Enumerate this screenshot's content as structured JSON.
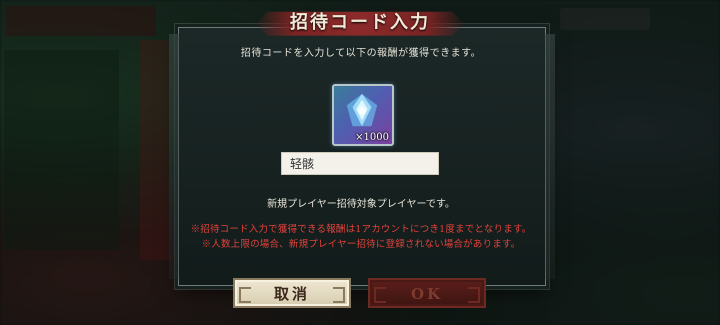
{
  "dialog": {
    "title": "招待コード入力",
    "subtitle": "招待コードを入力して以下の報酬が獲得できます。",
    "reward": {
      "icon": "crystal-icon",
      "quantity": "×1000"
    },
    "input_value": "轻骸",
    "info": "新規プレイヤー招待対象プレイヤーです。",
    "notes": [
      "※招待コード入力で獲得できる報酬は1アカウントにつき1度までとなります。",
      "※人数上限の場合、新規プレイヤー招待に登録されない場合があります。"
    ],
    "buttons": {
      "cancel": "取消",
      "ok": "OK"
    }
  },
  "colors": {
    "title_banner": "#8c2a2a",
    "note_text": "#e0433c",
    "cancel_button": "#e6dcc2",
    "ok_button": "#4a1915"
  }
}
